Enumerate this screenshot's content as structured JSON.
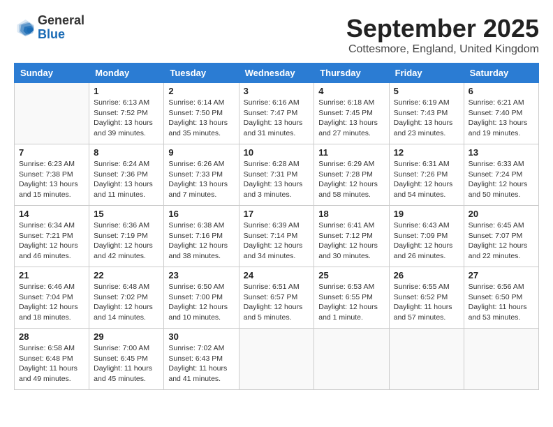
{
  "header": {
    "logo_general": "General",
    "logo_blue": "Blue",
    "month_title": "September 2025",
    "subtitle": "Cottesmore, England, United Kingdom"
  },
  "weekdays": [
    "Sunday",
    "Monday",
    "Tuesday",
    "Wednesday",
    "Thursday",
    "Friday",
    "Saturday"
  ],
  "weeks": [
    [
      {
        "day": "",
        "info": ""
      },
      {
        "day": "1",
        "info": "Sunrise: 6:13 AM\nSunset: 7:52 PM\nDaylight: 13 hours\nand 39 minutes."
      },
      {
        "day": "2",
        "info": "Sunrise: 6:14 AM\nSunset: 7:50 PM\nDaylight: 13 hours\nand 35 minutes."
      },
      {
        "day": "3",
        "info": "Sunrise: 6:16 AM\nSunset: 7:47 PM\nDaylight: 13 hours\nand 31 minutes."
      },
      {
        "day": "4",
        "info": "Sunrise: 6:18 AM\nSunset: 7:45 PM\nDaylight: 13 hours\nand 27 minutes."
      },
      {
        "day": "5",
        "info": "Sunrise: 6:19 AM\nSunset: 7:43 PM\nDaylight: 13 hours\nand 23 minutes."
      },
      {
        "day": "6",
        "info": "Sunrise: 6:21 AM\nSunset: 7:40 PM\nDaylight: 13 hours\nand 19 minutes."
      }
    ],
    [
      {
        "day": "7",
        "info": "Sunrise: 6:23 AM\nSunset: 7:38 PM\nDaylight: 13 hours\nand 15 minutes."
      },
      {
        "day": "8",
        "info": "Sunrise: 6:24 AM\nSunset: 7:36 PM\nDaylight: 13 hours\nand 11 minutes."
      },
      {
        "day": "9",
        "info": "Sunrise: 6:26 AM\nSunset: 7:33 PM\nDaylight: 13 hours\nand 7 minutes."
      },
      {
        "day": "10",
        "info": "Sunrise: 6:28 AM\nSunset: 7:31 PM\nDaylight: 13 hours\nand 3 minutes."
      },
      {
        "day": "11",
        "info": "Sunrise: 6:29 AM\nSunset: 7:28 PM\nDaylight: 12 hours\nand 58 minutes."
      },
      {
        "day": "12",
        "info": "Sunrise: 6:31 AM\nSunset: 7:26 PM\nDaylight: 12 hours\nand 54 minutes."
      },
      {
        "day": "13",
        "info": "Sunrise: 6:33 AM\nSunset: 7:24 PM\nDaylight: 12 hours\nand 50 minutes."
      }
    ],
    [
      {
        "day": "14",
        "info": "Sunrise: 6:34 AM\nSunset: 7:21 PM\nDaylight: 12 hours\nand 46 minutes."
      },
      {
        "day": "15",
        "info": "Sunrise: 6:36 AM\nSunset: 7:19 PM\nDaylight: 12 hours\nand 42 minutes."
      },
      {
        "day": "16",
        "info": "Sunrise: 6:38 AM\nSunset: 7:16 PM\nDaylight: 12 hours\nand 38 minutes."
      },
      {
        "day": "17",
        "info": "Sunrise: 6:39 AM\nSunset: 7:14 PM\nDaylight: 12 hours\nand 34 minutes."
      },
      {
        "day": "18",
        "info": "Sunrise: 6:41 AM\nSunset: 7:12 PM\nDaylight: 12 hours\nand 30 minutes."
      },
      {
        "day": "19",
        "info": "Sunrise: 6:43 AM\nSunset: 7:09 PM\nDaylight: 12 hours\nand 26 minutes."
      },
      {
        "day": "20",
        "info": "Sunrise: 6:45 AM\nSunset: 7:07 PM\nDaylight: 12 hours\nand 22 minutes."
      }
    ],
    [
      {
        "day": "21",
        "info": "Sunrise: 6:46 AM\nSunset: 7:04 PM\nDaylight: 12 hours\nand 18 minutes."
      },
      {
        "day": "22",
        "info": "Sunrise: 6:48 AM\nSunset: 7:02 PM\nDaylight: 12 hours\nand 14 minutes."
      },
      {
        "day": "23",
        "info": "Sunrise: 6:50 AM\nSunset: 7:00 PM\nDaylight: 12 hours\nand 10 minutes."
      },
      {
        "day": "24",
        "info": "Sunrise: 6:51 AM\nSunset: 6:57 PM\nDaylight: 12 hours\nand 5 minutes."
      },
      {
        "day": "25",
        "info": "Sunrise: 6:53 AM\nSunset: 6:55 PM\nDaylight: 12 hours\nand 1 minute."
      },
      {
        "day": "26",
        "info": "Sunrise: 6:55 AM\nSunset: 6:52 PM\nDaylight: 11 hours\nand 57 minutes."
      },
      {
        "day": "27",
        "info": "Sunrise: 6:56 AM\nSunset: 6:50 PM\nDaylight: 11 hours\nand 53 minutes."
      }
    ],
    [
      {
        "day": "28",
        "info": "Sunrise: 6:58 AM\nSunset: 6:48 PM\nDaylight: 11 hours\nand 49 minutes."
      },
      {
        "day": "29",
        "info": "Sunrise: 7:00 AM\nSunset: 6:45 PM\nDaylight: 11 hours\nand 45 minutes."
      },
      {
        "day": "30",
        "info": "Sunrise: 7:02 AM\nSunset: 6:43 PM\nDaylight: 11 hours\nand 41 minutes."
      },
      {
        "day": "",
        "info": ""
      },
      {
        "day": "",
        "info": ""
      },
      {
        "day": "",
        "info": ""
      },
      {
        "day": "",
        "info": ""
      }
    ]
  ]
}
